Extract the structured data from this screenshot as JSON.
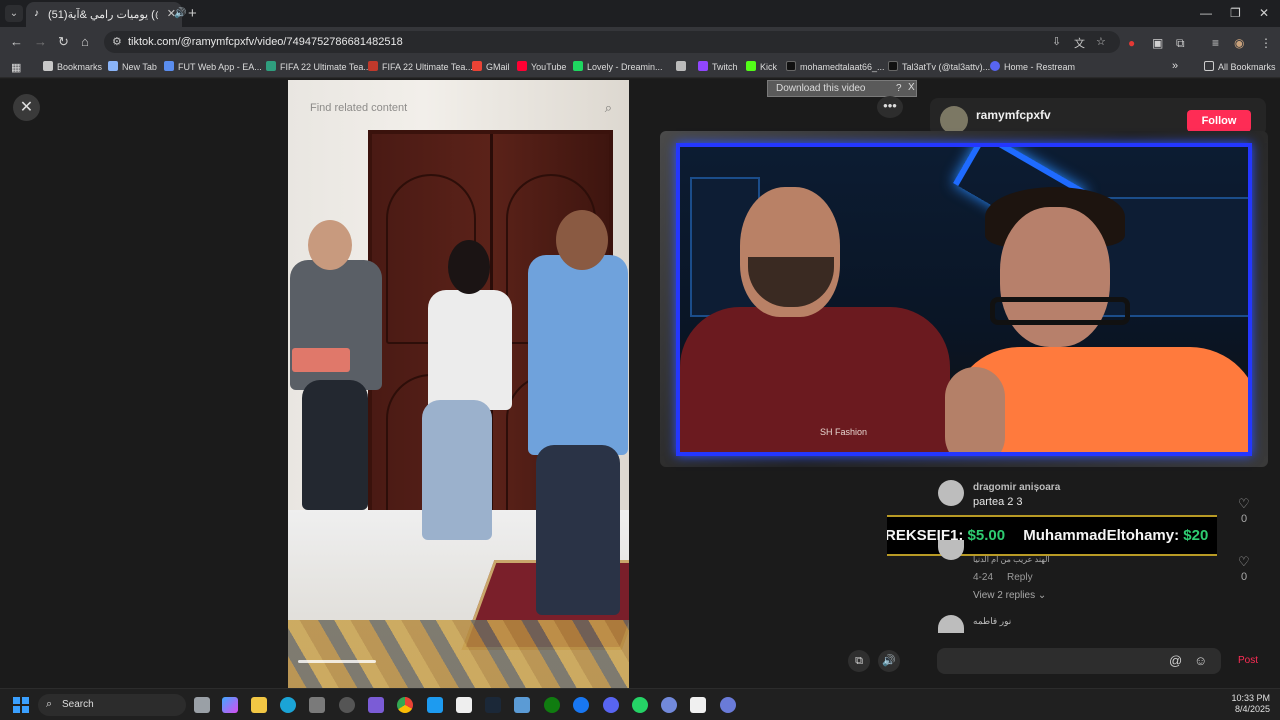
{
  "browser": {
    "tab": {
      "title": "(51)يوميات رامي &آية (@ramymfcpxfv"
    },
    "url": "tiktok.com/@ramymfcpxfv/video/7494752786681482518",
    "bookmarks": [
      {
        "label": "Bookmarks",
        "color": "#c8c8c8"
      },
      {
        "label": "New Tab",
        "color": "#8ab4f8"
      },
      {
        "label": "FUT Web App - EA...",
        "color": "#5a8dee"
      },
      {
        "label": "FIFA 22 Ultimate Tea...",
        "color": "#2f9e7e"
      },
      {
        "label": "FIFA 22 Ultimate Tea...",
        "color": "#c0392b"
      },
      {
        "label": "GMail",
        "color": "#ea4335"
      },
      {
        "label": "YouTube",
        "color": "#ff0033"
      },
      {
        "label": "Lovely - Dreamin...",
        "color": "#1ed760"
      },
      {
        "label": "",
        "color": "#bbbbbb"
      },
      {
        "label": "Twitch",
        "color": "#9146ff"
      },
      {
        "label": "Kick",
        "color": "#53fc18"
      },
      {
        "label": "mohamedtalaat66_...",
        "color": "#111111"
      },
      {
        "label": "Tal3atTv (@tal3attv)...",
        "color": "#111111"
      },
      {
        "label": "Home - Restream",
        "color": "#5865f2"
      }
    ],
    "all_bookmarks": "All Bookmarks"
  },
  "video": {
    "search_placeholder": "Find related content",
    "progress": 0.23
  },
  "download_bar": {
    "label": "Download this video",
    "help": "?",
    "close": "X"
  },
  "author": {
    "name": "ramymfcpxfv",
    "follow_label": "Follow"
  },
  "comments": [
    {
      "user": "dragomir anișoara",
      "text": "partea 2 3",
      "likes": "0"
    },
    {
      "user": "",
      "text": "الهند عريب من ام الدنيا",
      "date": "4-24",
      "reply_label": "Reply",
      "likes": "0",
      "view_replies": "View 2 replies"
    },
    {
      "user": "نور فاطمه"
    }
  ],
  "donation_ticker": [
    {
      "name": "REKSEIF1:",
      "amount": "$5.00"
    },
    {
      "name": "MuhammadEltohamy:",
      "amount": "$20"
    }
  ],
  "comment_box": {
    "post_label": "Post"
  },
  "stream_overlay": {
    "shirt_text": "SH Fashion"
  },
  "taskbar": {
    "search_label": "Search",
    "time": "10:33 PM",
    "date": "8/4/2025"
  }
}
